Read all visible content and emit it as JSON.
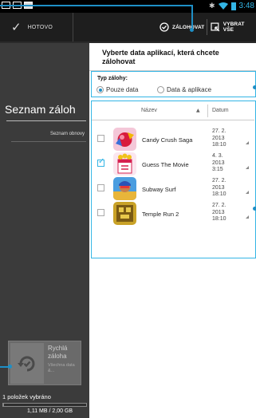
{
  "status_bar": {
    "time": "3:48"
  },
  "action_bar": {
    "done_label": "HOTOVO",
    "backup_label": "ZÁLOHOVAT",
    "select_all_label": "VYBRAT VŠE"
  },
  "sidebar": {
    "title": "Seznam záloh",
    "restore_item": "Seznam obnovy",
    "quick_backup": {
      "title": "Rychlá záloha",
      "subtitle": "Všechna data &..."
    },
    "selected_count_text": "1 položek vybráno",
    "storage_text": "1,11 MB / 2,00 GB",
    "storage_used_fraction": 0.0006
  },
  "main": {
    "title": "Vyberte data aplikací, která chcete zálohovat",
    "backup_type": {
      "label": "Typ zálohy:",
      "options": [
        "Pouze data",
        "Data & aplikace"
      ],
      "selected": "Pouze data"
    },
    "table": {
      "columns": [
        "Název",
        "Datum"
      ],
      "rows": [
        {
          "name": "Candy Crush Saga",
          "date": "27. 2.\n2013\n18:10",
          "checked": false,
          "icon": "candy-crush-saga-icon"
        },
        {
          "name": "Guess The Movie",
          "date": "4. 3.\n2013\n3:15",
          "checked": true,
          "icon": "guess-the-movie-icon"
        },
        {
          "name": "Subway Surf",
          "date": "27. 2.\n2013\n18:10",
          "checked": false,
          "icon": "subway-surf-icon"
        },
        {
          "name": "Temple Run 2",
          "date": "27. 2.\n2013\n18:10",
          "checked": false,
          "icon": "temple-run-2-icon"
        }
      ]
    }
  },
  "colors": {
    "accent": "#33b5e5",
    "annotation": "#1e8fc6",
    "sidebar_bg": "#3b3b3b",
    "actionbar_bg": "#1e1e1e"
  }
}
